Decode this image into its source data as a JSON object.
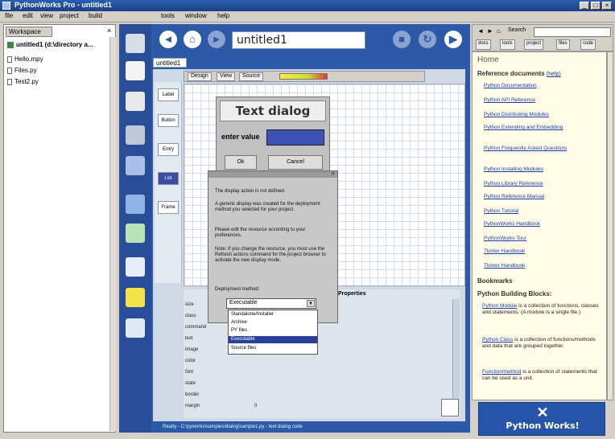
{
  "window": {
    "title": "PythonWorks Pro - untitled1",
    "controls": [
      "_",
      "□",
      "×"
    ]
  },
  "menubar": {
    "items": [
      "file",
      "edit",
      "view",
      "project",
      "build",
      "tools",
      "window",
      "help"
    ]
  },
  "workspace": {
    "tab": "Workspace",
    "close": "×",
    "items": [
      {
        "label": "untitled1 (d:\\directory a...",
        "type": "project"
      },
      {
        "label": "Hello.mpy",
        "type": "file"
      },
      {
        "label": "Files.py",
        "type": "file"
      },
      {
        "label": "Test2.py",
        "type": "file"
      }
    ]
  },
  "nav": {
    "back": "◄",
    "home": "⌂",
    "forward": "►",
    "title": "untitled1",
    "stop": "■",
    "reload": "↻",
    "go": "▶"
  },
  "editor": {
    "tab": "untitled1",
    "design_tabs": [
      "Design",
      "View",
      "Source"
    ],
    "tools": [
      "Label",
      "Button",
      "Entry",
      "List",
      "Frame"
    ],
    "dialog": {
      "title": "Text dialog",
      "label": "enter value",
      "ok": "Ok",
      "cancel": "Cancel"
    }
  },
  "popup": {
    "close": "×",
    "p1": "The display action is not defined.",
    "p2": "A generic display was created for the deployment method you selected for your project.",
    "p3": "Please edit the resource according to your preferences.",
    "p4": "Note: If you change the resource, you must use the Refresh actions command for the project browser to activate the new display mode.",
    "dep_label": "Deployment method:",
    "dep_value": "Executable",
    "dep_arrow": "▼",
    "options": [
      "Standalone/Installer",
      "Archive",
      "PY files",
      "Executable",
      "Source files"
    ],
    "selected_index": 3
  },
  "properties": {
    "title": "Properties",
    "rows": [
      "size",
      "class",
      "command",
      "text",
      "image",
      "color",
      "font",
      "state",
      "border",
      "margin"
    ],
    "margin_value": "0"
  },
  "statusbar": "Ready - C:\\pyworks\\samples\\dialog\\sample1.py - text dialog code",
  "help": {
    "nav_buttons": [
      "◄",
      "►",
      "⌂"
    ],
    "search_btn": "Search",
    "search_placeholder": "",
    "tabs": [
      "docs",
      "tools",
      "project",
      "files",
      "code"
    ],
    "heading": "Home",
    "ref_docs": "Reference documents",
    "ref_docs_link": "(help)",
    "ref_links": [
      "Python Documentation",
      "Python API Reference",
      "Python Distributing Modules",
      "Python Extending and Embedding",
      "Python Frequently Asked Questions",
      "Python Installing Modules",
      "Python Library Reference",
      "Python Reference Manual",
      "Python Tutorial",
      "PythonWorks Handbook",
      "PythonWorks Tour",
      "Tkinter Handbook",
      "Tkinter Handbook"
    ],
    "bookmarks": "Bookmarks",
    "blocks_title": "Python Building Blocks:",
    "block1_link": "Python Module",
    "block1_text": " is a collection of functions, classes and statements. (A module is a single file.)",
    "block2_link": "Python Class",
    "block2_text": " is a collection of functions/methods and data that are grouped together.",
    "block3_link": "Function/method",
    "block3_text": " is a collection of statements that can be used as a unit.",
    "banner_icon": "✕",
    "banner_text": "Python Works!"
  }
}
